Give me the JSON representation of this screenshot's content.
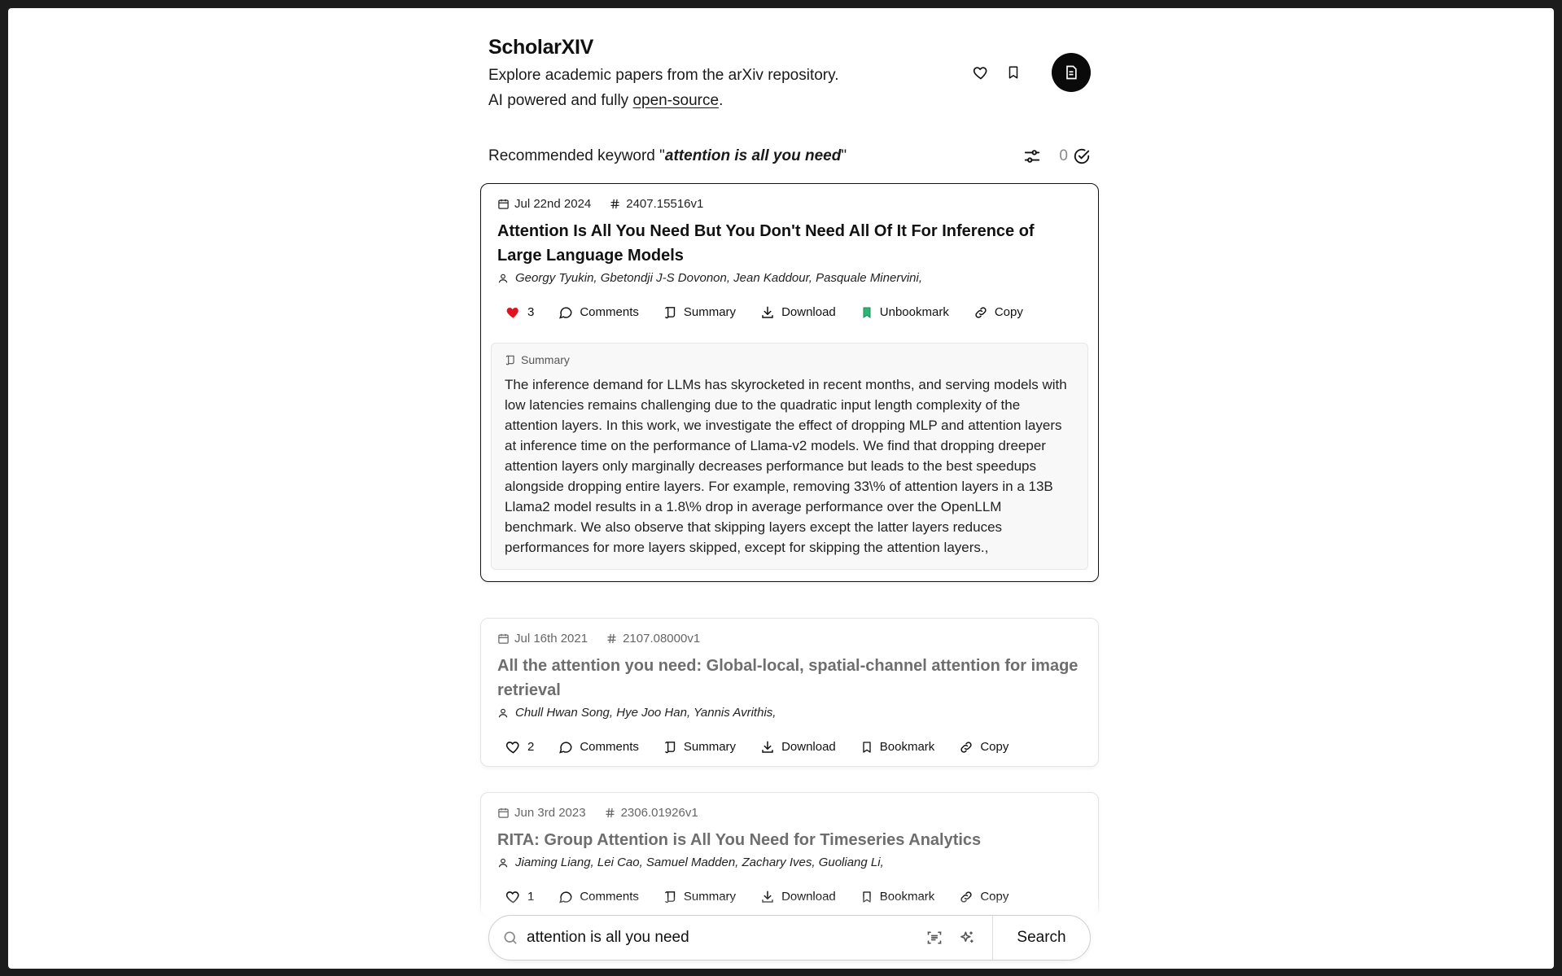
{
  "header": {
    "brand": "ScholarXIV",
    "tagline_line1": "Explore academic papers from the arXiv repository.",
    "tagline_line2_prefix": "AI powered and fully ",
    "tagline_link": "open-source",
    "tagline_line2_suffix": "."
  },
  "recommend": {
    "prefix": "Recommended keyword \"",
    "keyword": "attention is all you need",
    "suffix": "\"",
    "count": "0"
  },
  "papers": [
    {
      "date": "Jul 22nd 2024",
      "id": "2407.15516v1",
      "title": "Attention Is All You Need But You Don't Need All Of It For Inference of Large Language Models",
      "authors": "Georgy Tyukin, Gbetondji J-S Dovonon, Jean Kaddour, Pasquale Minervini,",
      "likes": "3",
      "comments_label": "Comments",
      "summary_label": "Summary",
      "download_label": "Download",
      "bookmark_label": "Unbookmark",
      "copy_label": "Copy",
      "summary_heading": "Summary",
      "summary": "The inference demand for LLMs has skyrocketed in recent months, and serving models with low latencies remains challenging due to the quadratic input length complexity of the attention layers. In this work, we investigate the effect of dropping MLP and attention layers at inference time on the performance of Llama-v2 models. We find that dropping dreeper attention layers only marginally decreases performance but leads to the best speedups alongside dropping entire layers. For example, removing 33\\% of attention layers in a 13B Llama2 model results in a 1.8\\% drop in average performance over the OpenLLM benchmark. We also observe that skipping layers except the latter layers reduces performances for more layers skipped, except for skipping the attention layers.,"
    },
    {
      "date": "Jul 16th 2021",
      "id": "2107.08000v1",
      "title": "All the attention you need: Global-local, spatial-channel attention for image retrieval",
      "authors": "Chull Hwan Song, Hye Joo Han, Yannis Avrithis,",
      "likes": "2",
      "comments_label": "Comments",
      "summary_label": "Summary",
      "download_label": "Download",
      "bookmark_label": "Bookmark",
      "copy_label": "Copy"
    },
    {
      "date": "Jun 3rd 2023",
      "id": "2306.01926v1",
      "title": "RITA: Group Attention is All You Need for Timeseries Analytics",
      "authors": "Jiaming Liang, Lei Cao, Samuel Madden, Zachary Ives, Guoliang Li,",
      "likes": "1",
      "comments_label": "Comments",
      "summary_label": "Summary",
      "download_label": "Download",
      "bookmark_label": "Bookmark",
      "copy_label": "Copy"
    }
  ],
  "search": {
    "value": "attention is all you need",
    "button_label": "Search"
  },
  "colors": {
    "heart_filled": "#e0141e",
    "bookmark_filled": "#2bb673",
    "avatar_bg": "#0a0a0a"
  }
}
